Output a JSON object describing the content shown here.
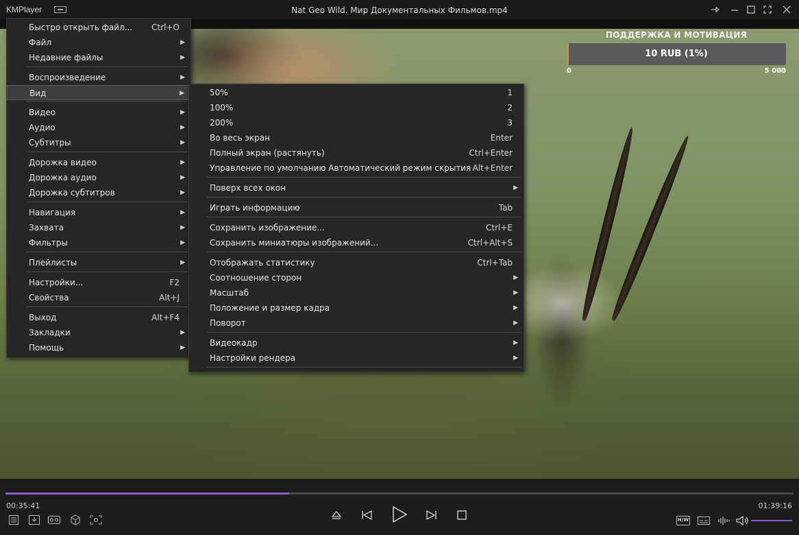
{
  "titlebar": {
    "app_name": "KMPlayer",
    "window_title": "Nat Geo Wild. Мир Документальных Фильмов.mp4",
    "controls": [
      "pin-icon",
      "minimize-icon",
      "maximize-icon",
      "close-icon"
    ]
  },
  "overlay": {
    "title": "ПОДДЕРЖКА И МОТИВАЦИЯ",
    "amount": "10 RUB (1%)",
    "progress_percent": 1,
    "min": "0",
    "max": "5 000"
  },
  "main_menu": {
    "items": [
      {
        "label": "Быстро открыть файл...",
        "shortcut": "Ctrl+O"
      },
      {
        "label": "Файл",
        "submenu": true
      },
      {
        "label": "Недавние файлы",
        "submenu": true
      },
      {
        "label": "Воспроизведение",
        "submenu": true
      },
      {
        "label": "Вид",
        "submenu": true,
        "highlighted": true
      },
      {
        "label": "Видео",
        "submenu": true
      },
      {
        "label": "Аудио",
        "submenu": true
      },
      {
        "label": "Субтитры",
        "submenu": true
      },
      {
        "label": "Дорожка видео",
        "submenu": true
      },
      {
        "label": "Дорожка аудио",
        "submenu": true
      },
      {
        "label": "Дорожка субтитров",
        "submenu": true
      },
      {
        "label": "Навигация",
        "submenu": true
      },
      {
        "label": "Захвата",
        "submenu": true
      },
      {
        "label": "Фильтры",
        "submenu": true
      },
      {
        "label": "Плейлисты",
        "submenu": true
      },
      {
        "label": "Настройки...",
        "shortcut": "F2"
      },
      {
        "label": "Свойства",
        "shortcut": "Alt+J"
      },
      {
        "label": "Выход",
        "shortcut": "Alt+F4"
      },
      {
        "label": "Закладки",
        "submenu": true
      },
      {
        "label": "Помощь",
        "submenu": true
      }
    ]
  },
  "view_submenu": {
    "items": [
      {
        "label": "50%",
        "shortcut": "1"
      },
      {
        "label": "100%",
        "shortcut": "2"
      },
      {
        "label": "200%",
        "shortcut": "3"
      },
      {
        "label": "Во весь экран",
        "shortcut": "Enter"
      },
      {
        "label": "Полный экран (растянуть)",
        "shortcut": "Ctrl+Enter"
      },
      {
        "label": "Управление по умолчанию Автоматический режим скрытия",
        "shortcut": "Alt+Enter"
      },
      {
        "label": "Поверх всех окон",
        "submenu": true
      },
      {
        "label": "Играть информацию",
        "shortcut": "Tab"
      },
      {
        "label": "Сохранить изображение...",
        "shortcut": "Ctrl+E"
      },
      {
        "label": "Сохранить миниатюры изображений...",
        "shortcut": "Ctrl+Alt+S"
      },
      {
        "label": "Отображать статистику",
        "shortcut": "Ctrl+Tab"
      },
      {
        "label": "Соотношение сторон",
        "submenu": true
      },
      {
        "label": "Масштаб",
        "submenu": true
      },
      {
        "label": "Положение и размер кадра",
        "submenu": true
      },
      {
        "label": "Поворот",
        "submenu": true
      },
      {
        "label": "Видеокадр",
        "submenu": true
      },
      {
        "label": "Настройки рендера",
        "submenu": true
      }
    ]
  },
  "player": {
    "current_time": "00:35:41",
    "total_time": "01:39:16",
    "progress_fraction": 0.36,
    "hw_label": "H/W",
    "accent_color": "#8b5cd9"
  },
  "colors": {
    "menu_bg": "#262626",
    "highlight_bg": "#3e3e3e",
    "donate_fill": "#e08a2a"
  }
}
